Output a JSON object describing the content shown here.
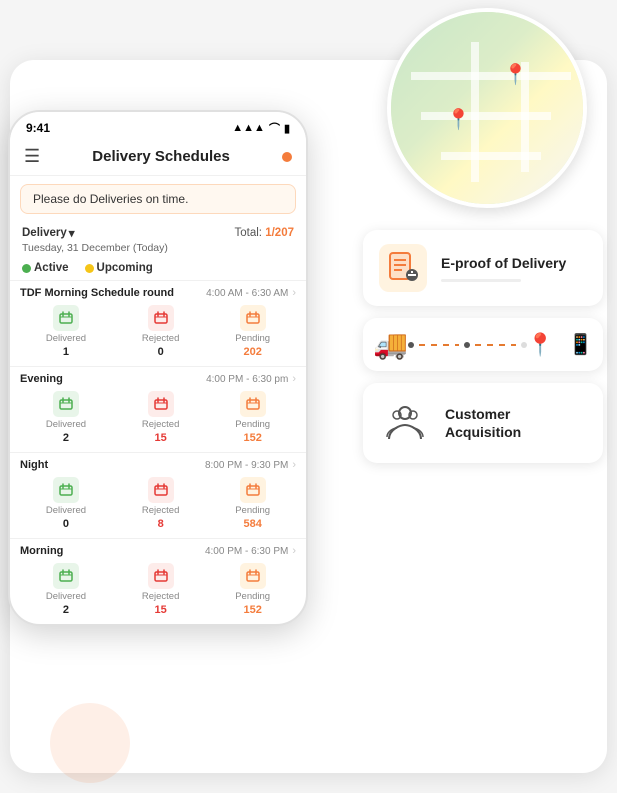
{
  "app": {
    "title": "Delivery Schedules",
    "time": "9:41",
    "signal_icon": "📶",
    "wifi_icon": "WiFi",
    "battery_icon": "🔋"
  },
  "header": {
    "menu_icon": "☰",
    "title": "Delivery Schedules"
  },
  "notification": {
    "text": "Please do Deliveries on time."
  },
  "delivery": {
    "label": "Delivery",
    "date": "Tuesday, 31 December (Today)",
    "total_label": "Total:",
    "total_value": "1/207"
  },
  "status": {
    "active": "Active",
    "upcoming": "Upcoming"
  },
  "schedules": [
    {
      "name": "TDF Morning Schedule round",
      "time": "4:00 AM - 6:30 AM",
      "delivered_count": "1",
      "rejected_count": "0",
      "pending_count": "202",
      "delivered_label": "Delivered",
      "rejected_label": "Rejected",
      "pending_label": "Pending"
    },
    {
      "name": "Evening",
      "time": "4:00 PM - 6:30 pm",
      "delivered_count": "2",
      "rejected_count": "15",
      "pending_count": "152",
      "delivered_label": "Delivered",
      "rejected_label": "Rejected",
      "pending_label": "Pending"
    },
    {
      "name": "Night",
      "time": "8:00 PM - 9:30 PM",
      "delivered_count": "0",
      "rejected_count": "8",
      "pending_count": "584",
      "delivered_label": "Delivered",
      "rejected_label": "Rejected",
      "pending_label": "Pending"
    },
    {
      "name": "Morning",
      "time": "4:00 PM - 6:30 PM",
      "delivered_count": "2",
      "rejected_count": "15",
      "pending_count": "152",
      "delivered_label": "Delivered",
      "rejected_label": "Rejected",
      "pending_label": "Pending"
    }
  ],
  "eproof": {
    "title": "E-proof of Delivery",
    "icon": "📦"
  },
  "customer": {
    "title": "Customer\nAcquisition",
    "icon": "🤲"
  },
  "colors": {
    "primary": "#f47c3c",
    "green": "#4caf50",
    "red": "#e53935",
    "yellow": "#f5c518"
  }
}
